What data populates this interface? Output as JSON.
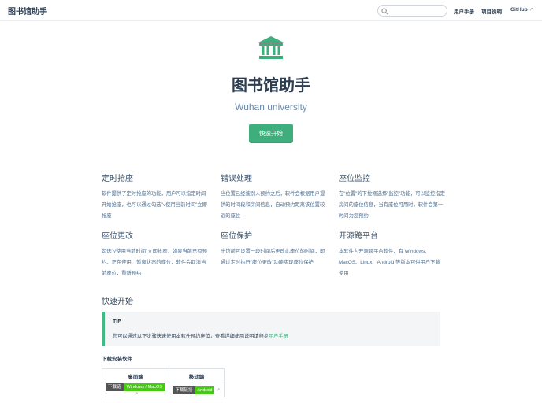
{
  "nav": {
    "brand": "图书馆助手",
    "search_placeholder": "",
    "links": [
      "用户手册",
      "项目说明",
      "GitHub"
    ]
  },
  "hero": {
    "title": "图书馆助手",
    "subtitle": "Wuhan university",
    "cta": "快速开始"
  },
  "features": [
    {
      "title": "定时抢座",
      "desc": "软件提供了定时抢座的功能，用户可以指定时间开始抢座，也可以通过勾选\"√使用当前时间\"立即抢座"
    },
    {
      "title": "错误处理",
      "desc": "当位置已经被别人预约之后，软件会根据用户提供的时间段和房间信息，自动预约距离该位置较近的座位"
    },
    {
      "title": "座位监控",
      "desc": "在\"位置\"的下拉框选择\"监控\"功能，可以监控指定房间的座位信息，当有座位可用时，软件会第一时间为您预约"
    },
    {
      "title": "座位更改",
      "desc": "勾选\"√使用当前时间\"立即抢座，如果当前已有预约、正在使用、暂离状态的座位，软件会取消当前座位，重新预约"
    },
    {
      "title": "座位保护",
      "desc": "出馆前可设置一段时间后更改此座位的时间，即通过定时执行\"座位更改\"功能实现座位保护"
    },
    {
      "title": "开源跨平台",
      "desc": "本软件为开源跨平台软件，有 Windows、MacOS、Linux、Android 等版本可供用户下载使用"
    }
  ],
  "quickstart": {
    "heading": "快速开始",
    "tip_title": "TIP",
    "tip_text": "您可以通过以下步骤快速使用本软件预约座位，查看详细使用说明请移步",
    "tip_link": "用户手册",
    "download_label": "下载安装软件",
    "table": {
      "headers": [
        "桌面端",
        "移动端"
      ],
      "badges": [
        {
          "label": "下载链接",
          "value": "Windows / MacOS / Linux"
        },
        {
          "label": "下载链接",
          "value": "Android"
        }
      ]
    }
  },
  "colors": {
    "accent": "#3eaf7c"
  }
}
